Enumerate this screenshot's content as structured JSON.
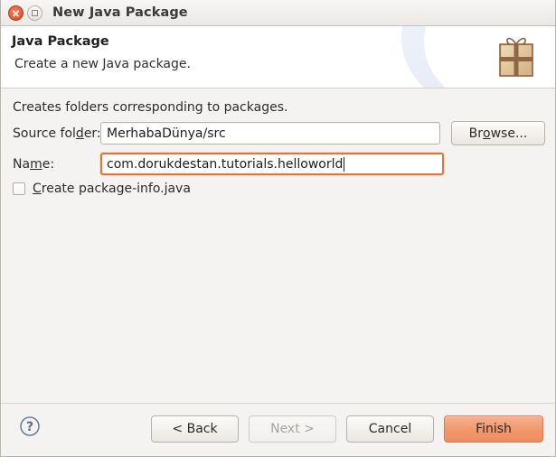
{
  "titlebar": {
    "title": "New Java Package",
    "close_icon": "close-icon",
    "maximize_icon": "maximize-icon"
  },
  "header": {
    "title": "Java Package",
    "subtitle": "Create a new Java package.",
    "icon": "package-box-icon"
  },
  "body": {
    "intro": "Creates folders corresponding to packages.",
    "source_folder": {
      "label_pre": "Source fol",
      "label_mn": "d",
      "label_post": "er:",
      "value": "MerhabaDünya/src"
    },
    "browse": {
      "label_pre": "Br",
      "label_mn": "o",
      "label_post": "wse..."
    },
    "name": {
      "label_pre": "Na",
      "label_mn": "m",
      "label_post": "e:",
      "value": "com.dorukdestan.tutorials.helloworld"
    },
    "package_info": {
      "label_mn": "C",
      "label_post": "reate package-info.java",
      "checked": false
    }
  },
  "footer": {
    "help_icon": "help-question-icon",
    "back": "< Back",
    "next": "Next >",
    "cancel": "Cancel",
    "finish": "Finish"
  },
  "colors": {
    "accent_orange": "#e2743a",
    "finish_button": "#f29a70",
    "close_button": "#df5b31",
    "window_bg": "#f4f3f1",
    "header_bg": "#ffffff"
  }
}
